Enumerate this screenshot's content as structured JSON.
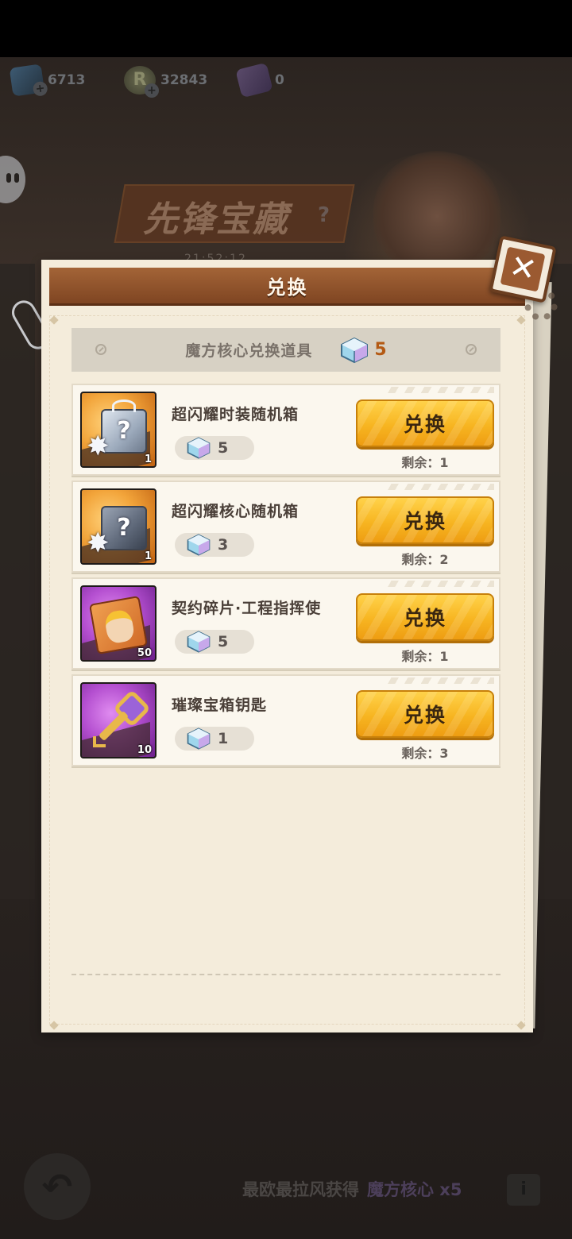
{
  "currencies": [
    {
      "icon": "gem-icon",
      "value": "6713"
    },
    {
      "icon": "coin-icon",
      "value": "32843",
      "glyph": "R"
    },
    {
      "icon": "card-icon",
      "value": "0"
    }
  ],
  "background": {
    "banner_title": "先锋宝藏",
    "banner_mark": "?",
    "timer": "21:52:12",
    "hint_prefix": "最欧最拉风获得",
    "hint_highlight": "魔方核心 x5",
    "info_glyph": "i",
    "back_glyph": "↶"
  },
  "modal": {
    "title": "兑换",
    "close_glyph": "✕",
    "strip_label": "魔方核心兑换道具",
    "owned_count": "5",
    "currency_icon": "cube-core-icon",
    "items": [
      {
        "name": "超闪耀时装随机箱",
        "cost": "5",
        "button": "兑换",
        "remaining": "剩余：1",
        "qty": "1",
        "rarity_color": "#f2a43a",
        "icon": "fashion-box-icon"
      },
      {
        "name": "超闪耀核心随机箱",
        "cost": "3",
        "button": "兑换",
        "remaining": "剩余：2",
        "qty": "1",
        "rarity_color": "#f2a43a",
        "icon": "core-box-icon"
      },
      {
        "name": "契约碎片·工程指挥使",
        "cost": "5",
        "button": "兑换",
        "remaining": "剩余：1",
        "qty": "50",
        "rarity_color": "#b44fd0",
        "icon": "contract-fragment-icon"
      },
      {
        "name": "璀璨宝箱钥匙",
        "cost": "1",
        "button": "兑换",
        "remaining": "剩余：3",
        "qty": "10",
        "rarity_color": "#b44fd0",
        "icon": "chest-key-icon"
      }
    ]
  }
}
